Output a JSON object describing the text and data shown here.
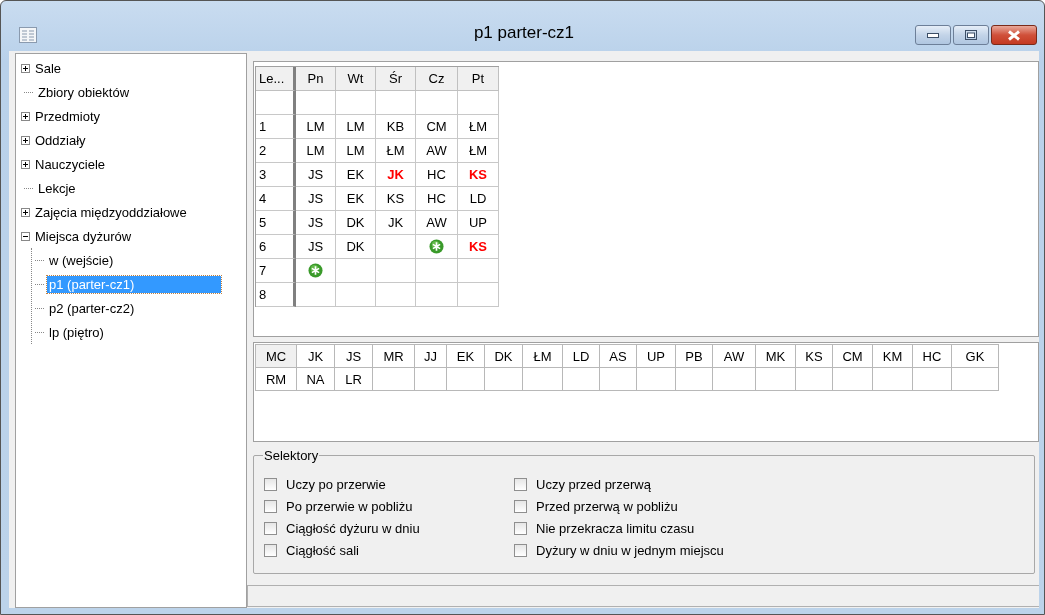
{
  "window": {
    "title": "p1 parter-cz1"
  },
  "tree": {
    "items": [
      {
        "label": "Sale",
        "kind": "folder",
        "expanded": false,
        "selected": false
      },
      {
        "label": "Zbiory obiektów",
        "kind": "leaf",
        "selected": false
      },
      {
        "label": "Przedmioty",
        "kind": "folder",
        "expanded": false,
        "selected": false
      },
      {
        "label": "Oddziały",
        "kind": "folder",
        "expanded": false,
        "selected": false
      },
      {
        "label": "Nauczyciele",
        "kind": "folder",
        "expanded": false,
        "selected": false
      },
      {
        "label": "Lekcje",
        "kind": "leaf",
        "selected": false
      },
      {
        "label": "Zajęcia międzyoddziałowe",
        "kind": "folder",
        "expanded": false,
        "selected": false
      },
      {
        "label": "Miejsca dyżurów",
        "kind": "folder",
        "expanded": true,
        "selected": false,
        "children": [
          {
            "label": "w (wejście)",
            "kind": "leaf",
            "selected": false
          },
          {
            "label": "p1 (parter-cz1)",
            "kind": "leaf",
            "selected": true
          },
          {
            "label": "p2 (parter-cz2)",
            "kind": "leaf",
            "selected": false
          },
          {
            "label": "lp (piętro)",
            "kind": "leaf",
            "selected": false
          }
        ]
      }
    ]
  },
  "schedule": {
    "corner": "Le...",
    "columns": [
      "Pn",
      "Wt",
      "Śr",
      "Cz",
      "Pt"
    ],
    "rows": [
      {
        "cells": [
          {
            "kind": "empty"
          },
          {
            "kind": "empty"
          },
          {
            "kind": "empty"
          },
          {
            "kind": "empty"
          },
          {
            "kind": "empty"
          }
        ]
      },
      {
        "label": "1",
        "cells": [
          {
            "kind": "text",
            "text": "LM",
            "conflict": false
          },
          {
            "kind": "text",
            "text": "LM",
            "conflict": false
          },
          {
            "kind": "text",
            "text": "KB",
            "conflict": false
          },
          {
            "kind": "text",
            "text": "CM",
            "conflict": false
          },
          {
            "kind": "text",
            "text": "ŁM",
            "conflict": false
          }
        ]
      },
      {
        "label": "2",
        "cells": [
          {
            "kind": "text",
            "text": "LM",
            "conflict": false
          },
          {
            "kind": "text",
            "text": "LM",
            "conflict": false
          },
          {
            "kind": "text",
            "text": "ŁM",
            "conflict": false
          },
          {
            "kind": "text",
            "text": "AW",
            "conflict": false
          },
          {
            "kind": "text",
            "text": "ŁM",
            "conflict": false
          }
        ]
      },
      {
        "label": "3",
        "cells": [
          {
            "kind": "text",
            "text": "JS",
            "conflict": false
          },
          {
            "kind": "text",
            "text": "EK",
            "conflict": false
          },
          {
            "kind": "text",
            "text": "JK",
            "conflict": true
          },
          {
            "kind": "text",
            "text": "HC",
            "conflict": false
          },
          {
            "kind": "text",
            "text": "KS",
            "conflict": true
          }
        ]
      },
      {
        "label": "4",
        "cells": [
          {
            "kind": "text",
            "text": "JS",
            "conflict": false
          },
          {
            "kind": "text",
            "text": "EK",
            "conflict": false
          },
          {
            "kind": "text",
            "text": "KS",
            "conflict": false
          },
          {
            "kind": "text",
            "text": "HC",
            "conflict": false
          },
          {
            "kind": "text",
            "text": "LD",
            "conflict": false
          }
        ]
      },
      {
        "label": "5",
        "cells": [
          {
            "kind": "text",
            "text": "JS",
            "conflict": false
          },
          {
            "kind": "text",
            "text": "DK",
            "conflict": false
          },
          {
            "kind": "text",
            "text": "JK",
            "conflict": false
          },
          {
            "kind": "text",
            "text": "AW",
            "conflict": false
          },
          {
            "kind": "text",
            "text": "UP",
            "conflict": false
          }
        ]
      },
      {
        "label": "6",
        "cells": [
          {
            "kind": "text",
            "text": "JS",
            "conflict": false
          },
          {
            "kind": "text",
            "text": "DK",
            "conflict": false
          },
          {
            "kind": "empty"
          },
          {
            "kind": "marker"
          },
          {
            "kind": "text",
            "text": "KS",
            "conflict": true
          }
        ]
      },
      {
        "label": "7",
        "cells": [
          {
            "kind": "marker"
          },
          {
            "kind": "empty"
          },
          {
            "kind": "empty"
          },
          {
            "kind": "empty"
          },
          {
            "kind": "empty"
          }
        ]
      },
      {
        "label": "8",
        "cells": [
          {
            "kind": "empty"
          },
          {
            "kind": "empty"
          },
          {
            "kind": "empty"
          },
          {
            "kind": "empty"
          },
          {
            "kind": "empty"
          }
        ]
      }
    ]
  },
  "teachers": {
    "rows": [
      [
        {
          "kind": "teacher",
          "text": "MC",
          "selected": true
        },
        {
          "kind": "teacher",
          "text": "JK",
          "selected": false
        },
        {
          "kind": "teacher",
          "text": "JS",
          "selected": false
        },
        {
          "kind": "teacher",
          "text": "MR",
          "selected": false
        },
        {
          "kind": "teacher",
          "text": "JJ",
          "selected": false
        },
        {
          "kind": "teacher",
          "text": "EK",
          "selected": false
        },
        {
          "kind": "teacher",
          "text": "DK",
          "selected": false
        },
        {
          "kind": "teacher",
          "text": "ŁM",
          "selected": false
        },
        {
          "kind": "teacher",
          "text": "LD",
          "selected": false
        },
        {
          "kind": "teacher",
          "text": "AS",
          "selected": false
        },
        {
          "kind": "teacher",
          "text": "UP",
          "selected": false
        },
        {
          "kind": "teacher",
          "text": "PB",
          "selected": false
        },
        {
          "kind": "teacher",
          "text": "AW",
          "selected": false
        },
        {
          "kind": "teacher",
          "text": "MK",
          "selected": false
        },
        {
          "kind": "teacher",
          "text": "KS",
          "selected": false
        },
        {
          "kind": "teacher",
          "text": "CM",
          "selected": false
        },
        {
          "kind": "teacher",
          "text": "KM",
          "selected": false
        },
        {
          "kind": "teacher",
          "text": "HC",
          "selected": false
        },
        {
          "kind": "teacher",
          "text": "GK",
          "selected": false
        }
      ],
      [
        {
          "kind": "teacher",
          "text": "RM",
          "selected": false
        },
        {
          "kind": "teacher",
          "text": "NA",
          "selected": false
        },
        {
          "kind": "teacher",
          "text": "LR",
          "selected": false
        },
        {
          "kind": "empty"
        },
        {
          "kind": "empty"
        },
        {
          "kind": "empty"
        },
        {
          "kind": "empty"
        },
        {
          "kind": "empty"
        },
        {
          "kind": "empty"
        },
        {
          "kind": "empty"
        },
        {
          "kind": "empty"
        },
        {
          "kind": "empty"
        },
        {
          "kind": "empty"
        },
        {
          "kind": "empty"
        },
        {
          "kind": "empty"
        },
        {
          "kind": "empty"
        },
        {
          "kind": "empty"
        },
        {
          "kind": "empty"
        },
        {
          "kind": "empty"
        }
      ]
    ]
  },
  "selectors": {
    "title": "Selektory",
    "columns": [
      [
        {
          "label": "Uczy po przerwie",
          "checked": false
        },
        {
          "label": "Po przerwie w pobliżu",
          "checked": false
        },
        {
          "label": "Ciągłość dyżuru w dniu",
          "checked": false
        },
        {
          "label": "Ciągłość sali",
          "checked": false
        }
      ],
      [
        {
          "label": "Uczy przed przerwą",
          "checked": false
        },
        {
          "label": "Przed przerwą w pobliżu",
          "checked": false
        },
        {
          "label": "Nie przekracza limitu czasu",
          "checked": false
        },
        {
          "label": "Dyżury w dniu w jednym miejscu",
          "checked": false
        }
      ]
    ]
  }
}
